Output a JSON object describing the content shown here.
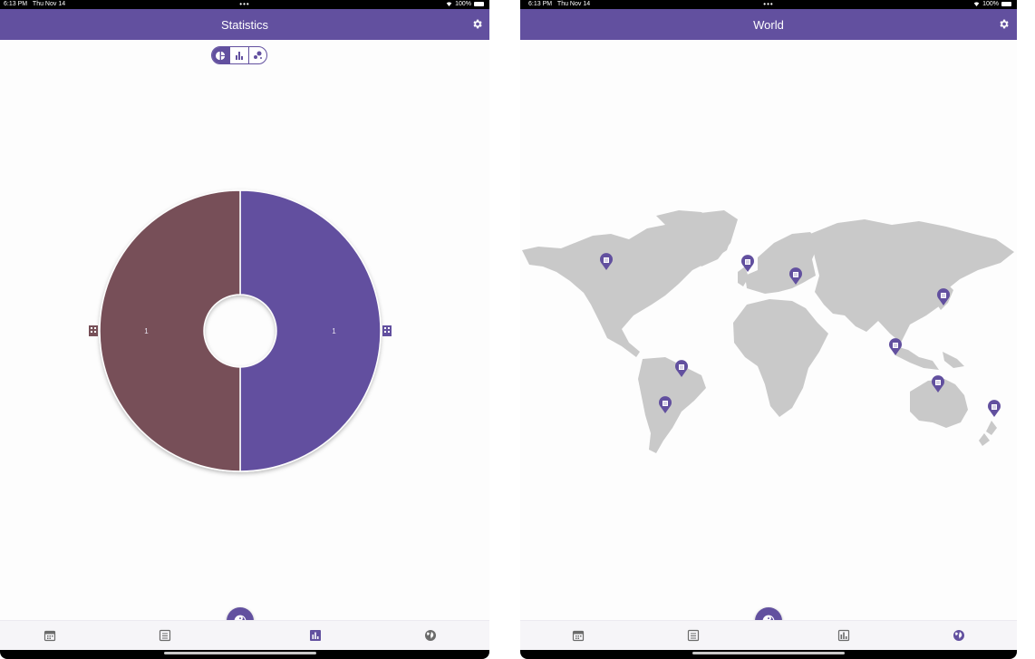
{
  "status_bar": {
    "time": "6:13 PM",
    "date": "Thu Nov 14",
    "dots": "•••",
    "battery": "100%"
  },
  "statistics_screen": {
    "title": "Statistics",
    "settings_icon": "gear-icon",
    "chart_type_toggle": {
      "options": [
        "pie-chart-icon",
        "bar-chart-icon",
        "scatter-icon"
      ],
      "selected": 0
    },
    "chart_data": {
      "type": "pie",
      "slices": [
        {
          "label": "1",
          "value": 1,
          "color": "#62509f",
          "icon": "building-icon"
        },
        {
          "label": "1",
          "value": 1,
          "color": "#775058",
          "icon": "building-icon"
        }
      ]
    }
  },
  "world_screen": {
    "title": "World",
    "settings_icon": "gear-icon",
    "map_pins": [
      "north-america",
      "western-europe",
      "eastern-europe",
      "east-asia",
      "southeast-asia",
      "south-america",
      "south-america-south",
      "australia",
      "new-zealand"
    ]
  },
  "bottom_nav": {
    "items": [
      "calendar-icon",
      "list-icon",
      "stats-icon",
      "globe-icon"
    ],
    "fab_icon": "yin-yang-icon"
  },
  "colors": {
    "accent": "#62509f",
    "secondary": "#775058",
    "map_land": "#c9c9c9"
  }
}
